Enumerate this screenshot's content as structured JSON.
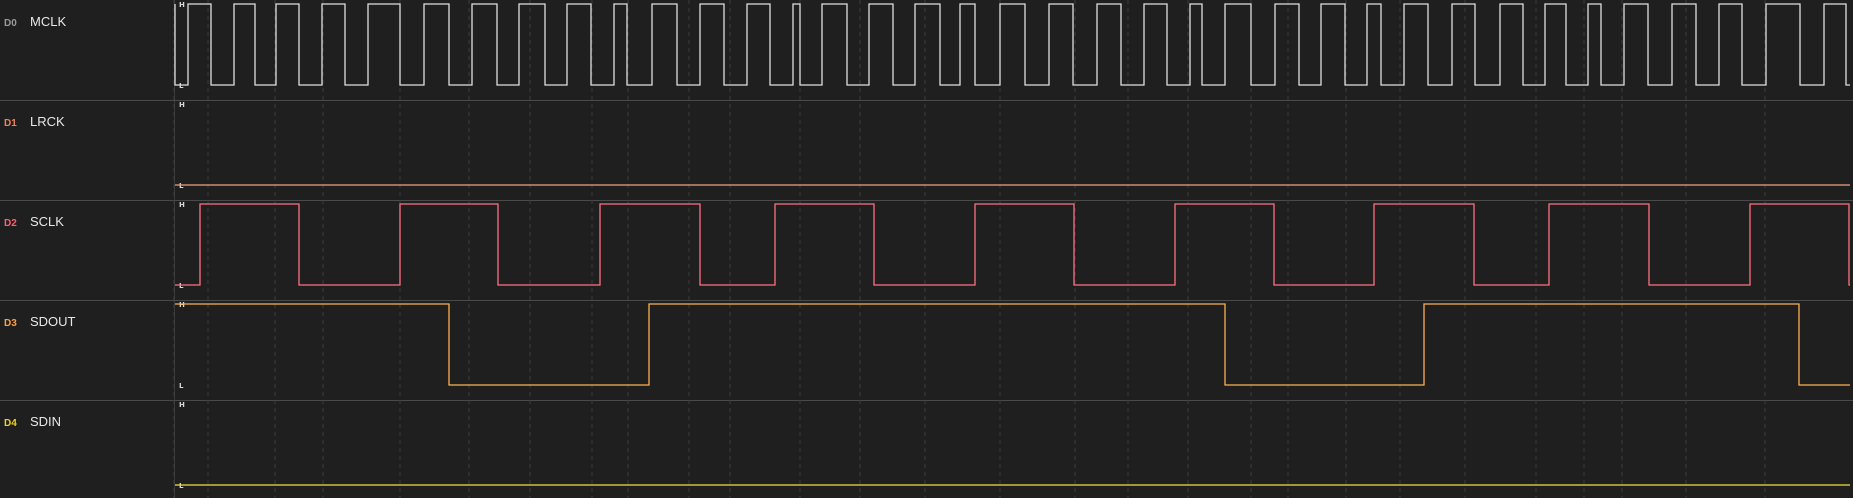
{
  "channels": [
    {
      "id": "D0",
      "name": "MCLK",
      "color": "#e0e0e0",
      "id_color": "#9a9a9a",
      "start": 1,
      "transitions": [
        175,
        188,
        211,
        234,
        255,
        276,
        299,
        322,
        345,
        368,
        400,
        424,
        449,
        472,
        497,
        519,
        545,
        567,
        591,
        614,
        627,
        652,
        677,
        700,
        724,
        747,
        770,
        793,
        800,
        822,
        847,
        869,
        893,
        915,
        940,
        960,
        975,
        1000,
        1025,
        1049,
        1073,
        1097,
        1121,
        1144,
        1167,
        1190,
        1202,
        1225,
        1251,
        1275,
        1299,
        1321,
        1345,
        1367,
        1381,
        1404,
        1428,
        1452,
        1475,
        1500,
        1523,
        1545,
        1566,
        1588,
        1601,
        1624,
        1648,
        1672,
        1696,
        1719,
        1742,
        1766,
        1800,
        1824,
        1846
      ]
    },
    {
      "id": "D1",
      "name": "LRCK",
      "color": "#f0a080",
      "id_color": "#f08060",
      "start": 0,
      "transitions": []
    },
    {
      "id": "D2",
      "name": "SCLK",
      "color": "#ff7080",
      "id_color": "#ff6070",
      "start": 0,
      "transitions": [
        200,
        299,
        400,
        498,
        600,
        700,
        775,
        874,
        975,
        1074,
        1175,
        1274,
        1374,
        1474,
        1549,
        1649,
        1750,
        1849
      ]
    },
    {
      "id": "D3",
      "name": "SDOUT",
      "color": "#ffb050",
      "id_color": "#ffa040",
      "start": 1,
      "transitions": [
        449,
        649,
        1225,
        1424,
        1799
      ]
    },
    {
      "id": "D4",
      "name": "SDIN",
      "color": "#f0e040",
      "id_color": "#f0d020",
      "start": 0,
      "transitions": []
    }
  ],
  "levels": {
    "high": "H",
    "low": "L"
  },
  "grid_x": [
    174,
    208,
    275,
    323,
    400,
    469,
    530,
    592,
    628,
    689,
    730,
    800,
    860,
    925,
    1000,
    1075,
    1128,
    1188,
    1251,
    1288,
    1346,
    1400,
    1465,
    1536,
    1584,
    1622,
    1686,
    1765
  ]
}
